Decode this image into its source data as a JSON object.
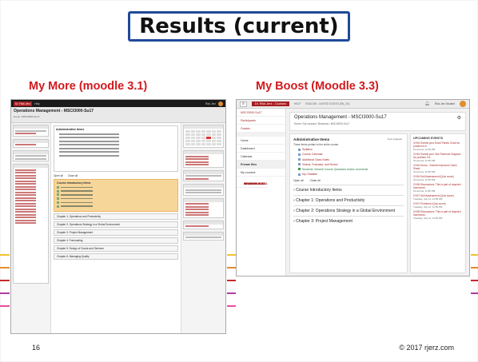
{
  "slide": {
    "title": "Results (current)",
    "left_caption": "My More (moodle 3.1)",
    "right_caption": "My Boost (Moodle 3.3)",
    "page_number": "16",
    "copyright": "© 2017 rjerz.com",
    "colors": {
      "title_border": "#1f4a9a",
      "caption": "#d2191d",
      "brand": "#a91e22"
    }
  },
  "shot_more": {
    "nav_name": "Dr. Rick Jerz",
    "nav_menu": "Help",
    "nav_user": "Rick Jerz",
    "course_title": "Operations Management - MSCI3000-Su17",
    "breadcrumb": "Home / MSCI3000-Su17",
    "admin_header": "Administrative Items",
    "open_all": "Open all",
    "close_all": "Close all",
    "intro_row": "Course Introductory Items",
    "sections": [
      "Chapter 1: Operations and Productivity",
      "Chapter 2: Operations Strategy in a Global Environment",
      "Chapter 3: Project Management",
      "Chapter 4: Forecasting",
      "Chapter 5: Design of Goods and Services",
      "Chapter 6: Managing Quality"
    ]
  },
  "shot_boost": {
    "nav_name": "Dr. Rick Jerz - Courses",
    "nav_help": "HELP",
    "nav_lang": "ENGLISH - UNITED STATES (EN_US)",
    "nav_user": "Rick Jerz Student",
    "left_nav": {
      "course": "MSCI3000-Su17",
      "participants": "Participants",
      "grades": "Grades",
      "home": "Home",
      "dashboard": "Dashboard",
      "calendar": "Calendar",
      "private_files": "Private files",
      "my_courses": "My courses",
      "courses": [
        "MBAM:00:17:GL",
        "MSCI3000-Su17",
        "MSCI3000-Su17",
        "MBAM:80-S17",
        "MBAM:80-S17",
        "MBAM:80-S17-DL",
        "MSCI3000-Su17"
      ],
      "see_all": "See..."
    },
    "course_title": "Operations Management - MSCI3000-Su17",
    "breadcrumb": "Home / My courses / Business / MSCI3000-Su17",
    "admin_header": "Administrative Items",
    "progress_label": "Your progress",
    "admin_desc": "These items pertain to the entire course.",
    "links": [
      "Syllabus",
      "Course Calendar",
      "Additional Class Notes",
      "Videos, Podcasts, and Runes"
    ],
    "green_link": "Students' General Course Questions and/or comments",
    "chat": "My Chatable",
    "open_all": "Open all",
    "close_all": "Close all",
    "sections": [
      "Course Introductory Items",
      "Chapter 1: Operations and Productivity",
      "Chapter 2: Operations Strategy in a Global Environment",
      "Chapter 3: Project Management"
    ],
    "events_header": "UPCOMING EVENTS",
    "events": [
      {
        "title": "CH04 Submit your Excel Pareto Chart for problem 6.5",
        "date": "Tomorrow, 11:55 PM"
      },
      {
        "title": "CH04 Submit your Vee Fishbone Diagram for problem 6.6",
        "date": "Tomorrow, 11:55 PM"
      },
      {
        "title": "CH04 Drone - Submit Improved Check Sheet",
        "date": "Tomorrow, 11:55 PM"
      },
      {
        "title": "CH04 Self Assessment (Quiz score)",
        "date": "Tomorrow, 11:55 PM"
      },
      {
        "title": "CH06 Discussions: This is part of required homework.",
        "date": "Tomorrow, 11:55 PM"
      },
      {
        "title": "CH07 Self Assessment (Quiz score)",
        "date": "Tuesday, July 11, 11:55 PM"
      },
      {
        "title": "CH07 Problems (Quiz score)",
        "date": "Tuesday, July 11, 11:55 PM"
      },
      {
        "title": "CH08 Discussions: This is part of required homework.",
        "date": "Tuesday, July 11, 11:55 PM"
      }
    ]
  }
}
